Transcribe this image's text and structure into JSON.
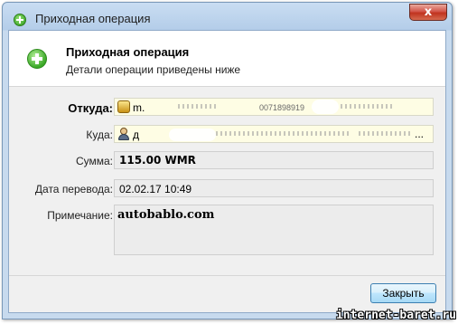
{
  "window": {
    "title": "Приходная операция",
    "close_glyph": "x"
  },
  "header": {
    "title": "Приходная операция",
    "subtitle": "Детали операции приведены ниже"
  },
  "fields": {
    "from_label": "Откуда:",
    "from_value": "m.",
    "from_value_tail": "0071898919",
    "to_label": "Куда:",
    "to_value": "д",
    "to_value_tail": "...",
    "amount_label": "Сумма:",
    "amount_value": "115.00 WMR",
    "date_label": "Дата перевода:",
    "date_value": "02.02.17 10:49",
    "note_label": "Примечание:",
    "note_value": "autobablo.com"
  },
  "footer": {
    "close_button_label": "Закрыть"
  },
  "watermark": "internet-baret.ru",
  "colors": {
    "field_highlight": "#fefde4",
    "button_border": "#3c7fb1",
    "title_bar": "#c9ddf2"
  }
}
